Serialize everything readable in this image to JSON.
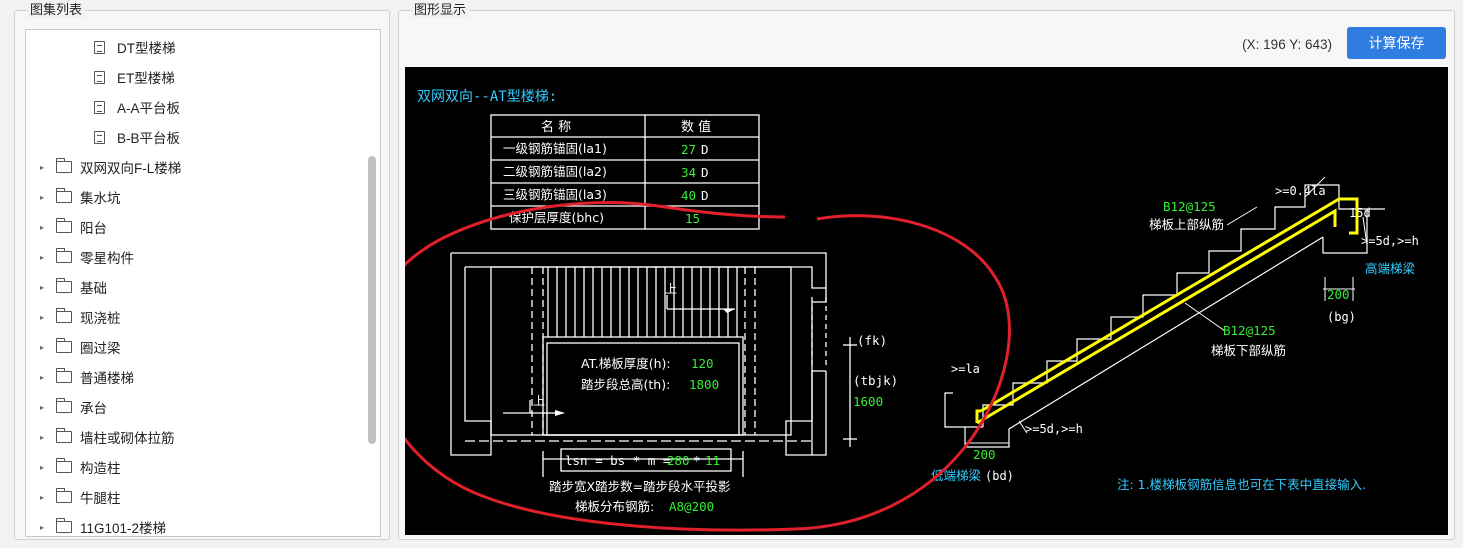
{
  "atlas_panel": {
    "title": "图集列表",
    "items": [
      {
        "type": "doc",
        "label": "DT型楼梯",
        "level": 1
      },
      {
        "type": "doc",
        "label": "ET型楼梯",
        "level": 1
      },
      {
        "type": "doc",
        "label": "A-A平台板",
        "level": 1
      },
      {
        "type": "doc",
        "label": "B-B平台板",
        "level": 1
      },
      {
        "type": "folder",
        "label": "双网双向F-L楼梯",
        "level": 0
      },
      {
        "type": "folder",
        "label": "集水坑",
        "level": 0
      },
      {
        "type": "folder",
        "label": "阳台",
        "level": 0
      },
      {
        "type": "folder",
        "label": "零星构件",
        "level": 0
      },
      {
        "type": "folder",
        "label": "基础",
        "level": 0
      },
      {
        "type": "folder",
        "label": "现浇桩",
        "level": 0
      },
      {
        "type": "folder",
        "label": "圈过梁",
        "level": 0
      },
      {
        "type": "folder",
        "label": "普通楼梯",
        "level": 0
      },
      {
        "type": "folder",
        "label": "承台",
        "level": 0
      },
      {
        "type": "folder",
        "label": "墙柱或砌体拉筋",
        "level": 0
      },
      {
        "type": "folder",
        "label": "构造柱",
        "level": 0
      },
      {
        "type": "folder",
        "label": "牛腿柱",
        "level": 0
      },
      {
        "type": "folder",
        "label": "11G101-2楼梯",
        "level": 0
      }
    ]
  },
  "display_panel": {
    "title": "图形显示",
    "coord_text": "(X: 196 Y: 643)",
    "save_label": "计算保存"
  },
  "drawing": {
    "title": "双网双向--AT型楼梯:",
    "table": {
      "headers": [
        "名  称",
        "数  值"
      ],
      "rows": [
        {
          "name": "一级钢筋锚固(la1)",
          "value": "27",
          "unit": "D"
        },
        {
          "name": "二级钢筋锚固(la2)",
          "value": "34",
          "unit": "D"
        },
        {
          "name": "三级钢筋锚固(la3)",
          "value": "40",
          "unit": "D"
        },
        {
          "name": "保护层厚度(bhc)",
          "value": "15",
          "unit": ""
        }
      ]
    },
    "plan": {
      "up_label_top": "上",
      "up_label_bottom": "上",
      "thickness_label": "AT.梯板厚度(h):",
      "thickness_value": "120",
      "height_label": "踏步段总高(th):",
      "height_value": "1800",
      "fk_label": "(fk)",
      "tbjk_label": "(tbjk)",
      "tbjk_value": "1600",
      "formula_prefix": "lsn = bs * m =",
      "formula_v1": "280",
      "formula_op": "*",
      "formula_v2": "11",
      "caption": "踏步宽X踏步数=踏步段水平投影",
      "dist_label": "梯板分布钢筋:",
      "dist_value": "A8@200"
    },
    "section": {
      "top_angle": ">=0.4la",
      "top_15d": "15d",
      "top_rebar_value": "B12@125",
      "top_rebar_label": "梯板上部纵筋",
      "high_end_note": ">=5d,>=h",
      "high_end_beam": "高端梯梁",
      "bg_value": "200",
      "bg_label": "(bg)",
      "bottom_rebar_value": "B12@125",
      "bottom_rebar_label": "梯板下部纵筋",
      "la_label": ">=la",
      "low_end_note": ">=5d,>=h",
      "bd_value": "200",
      "low_end_beam": "低端梯梁",
      "bd_label": "(bd)",
      "note": "注: 1.楼梯板钢筋信息也可在下表中直接输入."
    },
    "colors": {
      "background": "#000000",
      "line": "#ffffff",
      "value": "#33ee33",
      "cyan": "#33ccff",
      "rebar": "#ffff00",
      "annotation": "#e0202a"
    }
  }
}
